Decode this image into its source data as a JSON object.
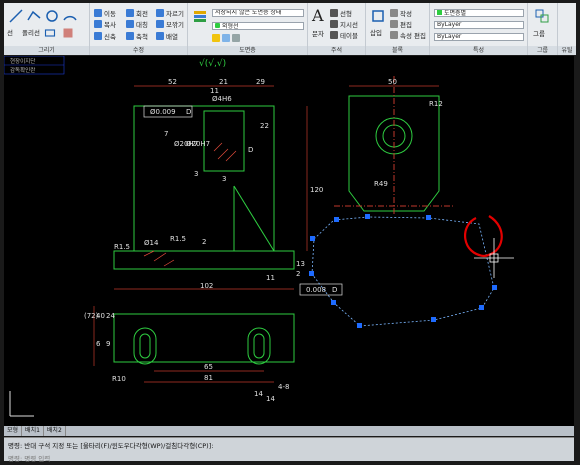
{
  "ribbon": {
    "panels": {
      "draw": "그리기",
      "modify": "수정",
      "layers": "도면층",
      "annotation": "주석",
      "block": "블록",
      "properties": "특성",
      "groups": "그룹",
      "utilities": "유틸"
    },
    "draw": {
      "line": "선",
      "polyline": "폴리선"
    },
    "modify": {
      "move": "이동",
      "rotate": "회전",
      "trim": "자르기",
      "copy": "복사",
      "mirror": "대칭",
      "fillet": "모깎기",
      "stretch": "신축",
      "scale": "축척",
      "array": "배열"
    },
    "layers": {
      "unsaved_state": "저장되지 않은 도면층 상태",
      "layer_name": "외형선"
    },
    "annotation": {
      "text": "문자",
      "dimension": "치수",
      "leader": "지시선",
      "table": "테이블",
      "linear": "선형"
    },
    "block": {
      "insert": "삽입",
      "create": "작성",
      "edit": "편집",
      "edit_attr": "속성 편집"
    },
    "properties": {
      "color": "도면층별",
      "linetype": "ByLayer",
      "lineweight": "ByLayer"
    },
    "groups": {
      "group": "그룹"
    }
  },
  "side_labels": [
    "현장이지단",
    "감독확인란"
  ],
  "drawing": {
    "dims_top": [
      "52",
      "21",
      "29",
      "11",
      "Ø4H6"
    ],
    "dims_misc": [
      "Ø0.009",
      "D",
      "22",
      "7",
      "Ø20H7",
      "Ø20H7",
      "3",
      "3",
      "2",
      "D",
      "R1.5",
      "Ø14",
      "R1.5",
      "13",
      "2",
      "102",
      "11",
      "0.008",
      "D"
    ],
    "dims_right": [
      "50",
      "R12",
      "120",
      "R49"
    ],
    "dims_bottom": [
      "(72)",
      "40",
      "24",
      "6",
      "9",
      "R10",
      "65",
      "81",
      "14",
      "4-8",
      "14"
    ],
    "titles": [
      "√(√,√)"
    ]
  },
  "layout_tabs": [
    "모형",
    "배치1",
    "배치2"
  ],
  "command": {
    "line1": "명령: 반대 구석 지정 또는 [울타리(F)/윈도우다각형(WP)/걸침다각형(CP)]:",
    "line2": "명령: 명령 입력"
  }
}
